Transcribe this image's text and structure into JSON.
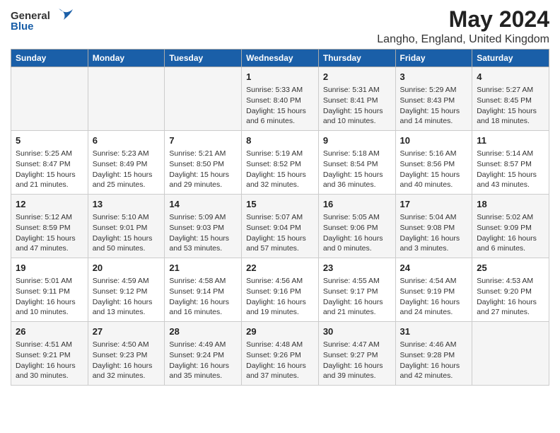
{
  "logo": {
    "general": "General",
    "blue": "Blue"
  },
  "title": "May 2024",
  "subtitle": "Langho, England, United Kingdom",
  "weekdays": [
    "Sunday",
    "Monday",
    "Tuesday",
    "Wednesday",
    "Thursday",
    "Friday",
    "Saturday"
  ],
  "weeks": [
    [
      {
        "day": "",
        "info": ""
      },
      {
        "day": "",
        "info": ""
      },
      {
        "day": "",
        "info": ""
      },
      {
        "day": "1",
        "info": "Sunrise: 5:33 AM\nSunset: 8:40 PM\nDaylight: 15 hours\nand 6 minutes."
      },
      {
        "day": "2",
        "info": "Sunrise: 5:31 AM\nSunset: 8:41 PM\nDaylight: 15 hours\nand 10 minutes."
      },
      {
        "day": "3",
        "info": "Sunrise: 5:29 AM\nSunset: 8:43 PM\nDaylight: 15 hours\nand 14 minutes."
      },
      {
        "day": "4",
        "info": "Sunrise: 5:27 AM\nSunset: 8:45 PM\nDaylight: 15 hours\nand 18 minutes."
      }
    ],
    [
      {
        "day": "5",
        "info": "Sunrise: 5:25 AM\nSunset: 8:47 PM\nDaylight: 15 hours\nand 21 minutes."
      },
      {
        "day": "6",
        "info": "Sunrise: 5:23 AM\nSunset: 8:49 PM\nDaylight: 15 hours\nand 25 minutes."
      },
      {
        "day": "7",
        "info": "Sunrise: 5:21 AM\nSunset: 8:50 PM\nDaylight: 15 hours\nand 29 minutes."
      },
      {
        "day": "8",
        "info": "Sunrise: 5:19 AM\nSunset: 8:52 PM\nDaylight: 15 hours\nand 32 minutes."
      },
      {
        "day": "9",
        "info": "Sunrise: 5:18 AM\nSunset: 8:54 PM\nDaylight: 15 hours\nand 36 minutes."
      },
      {
        "day": "10",
        "info": "Sunrise: 5:16 AM\nSunset: 8:56 PM\nDaylight: 15 hours\nand 40 minutes."
      },
      {
        "day": "11",
        "info": "Sunrise: 5:14 AM\nSunset: 8:57 PM\nDaylight: 15 hours\nand 43 minutes."
      }
    ],
    [
      {
        "day": "12",
        "info": "Sunrise: 5:12 AM\nSunset: 8:59 PM\nDaylight: 15 hours\nand 47 minutes."
      },
      {
        "day": "13",
        "info": "Sunrise: 5:10 AM\nSunset: 9:01 PM\nDaylight: 15 hours\nand 50 minutes."
      },
      {
        "day": "14",
        "info": "Sunrise: 5:09 AM\nSunset: 9:03 PM\nDaylight: 15 hours\nand 53 minutes."
      },
      {
        "day": "15",
        "info": "Sunrise: 5:07 AM\nSunset: 9:04 PM\nDaylight: 15 hours\nand 57 minutes."
      },
      {
        "day": "16",
        "info": "Sunrise: 5:05 AM\nSunset: 9:06 PM\nDaylight: 16 hours\nand 0 minutes."
      },
      {
        "day": "17",
        "info": "Sunrise: 5:04 AM\nSunset: 9:08 PM\nDaylight: 16 hours\nand 3 minutes."
      },
      {
        "day": "18",
        "info": "Sunrise: 5:02 AM\nSunset: 9:09 PM\nDaylight: 16 hours\nand 6 minutes."
      }
    ],
    [
      {
        "day": "19",
        "info": "Sunrise: 5:01 AM\nSunset: 9:11 PM\nDaylight: 16 hours\nand 10 minutes."
      },
      {
        "day": "20",
        "info": "Sunrise: 4:59 AM\nSunset: 9:12 PM\nDaylight: 16 hours\nand 13 minutes."
      },
      {
        "day": "21",
        "info": "Sunrise: 4:58 AM\nSunset: 9:14 PM\nDaylight: 16 hours\nand 16 minutes."
      },
      {
        "day": "22",
        "info": "Sunrise: 4:56 AM\nSunset: 9:16 PM\nDaylight: 16 hours\nand 19 minutes."
      },
      {
        "day": "23",
        "info": "Sunrise: 4:55 AM\nSunset: 9:17 PM\nDaylight: 16 hours\nand 21 minutes."
      },
      {
        "day": "24",
        "info": "Sunrise: 4:54 AM\nSunset: 9:19 PM\nDaylight: 16 hours\nand 24 minutes."
      },
      {
        "day": "25",
        "info": "Sunrise: 4:53 AM\nSunset: 9:20 PM\nDaylight: 16 hours\nand 27 minutes."
      }
    ],
    [
      {
        "day": "26",
        "info": "Sunrise: 4:51 AM\nSunset: 9:21 PM\nDaylight: 16 hours\nand 30 minutes."
      },
      {
        "day": "27",
        "info": "Sunrise: 4:50 AM\nSunset: 9:23 PM\nDaylight: 16 hours\nand 32 minutes."
      },
      {
        "day": "28",
        "info": "Sunrise: 4:49 AM\nSunset: 9:24 PM\nDaylight: 16 hours\nand 35 minutes."
      },
      {
        "day": "29",
        "info": "Sunrise: 4:48 AM\nSunset: 9:26 PM\nDaylight: 16 hours\nand 37 minutes."
      },
      {
        "day": "30",
        "info": "Sunrise: 4:47 AM\nSunset: 9:27 PM\nDaylight: 16 hours\nand 39 minutes."
      },
      {
        "day": "31",
        "info": "Sunrise: 4:46 AM\nSunset: 9:28 PM\nDaylight: 16 hours\nand 42 minutes."
      },
      {
        "day": "",
        "info": ""
      }
    ]
  ]
}
